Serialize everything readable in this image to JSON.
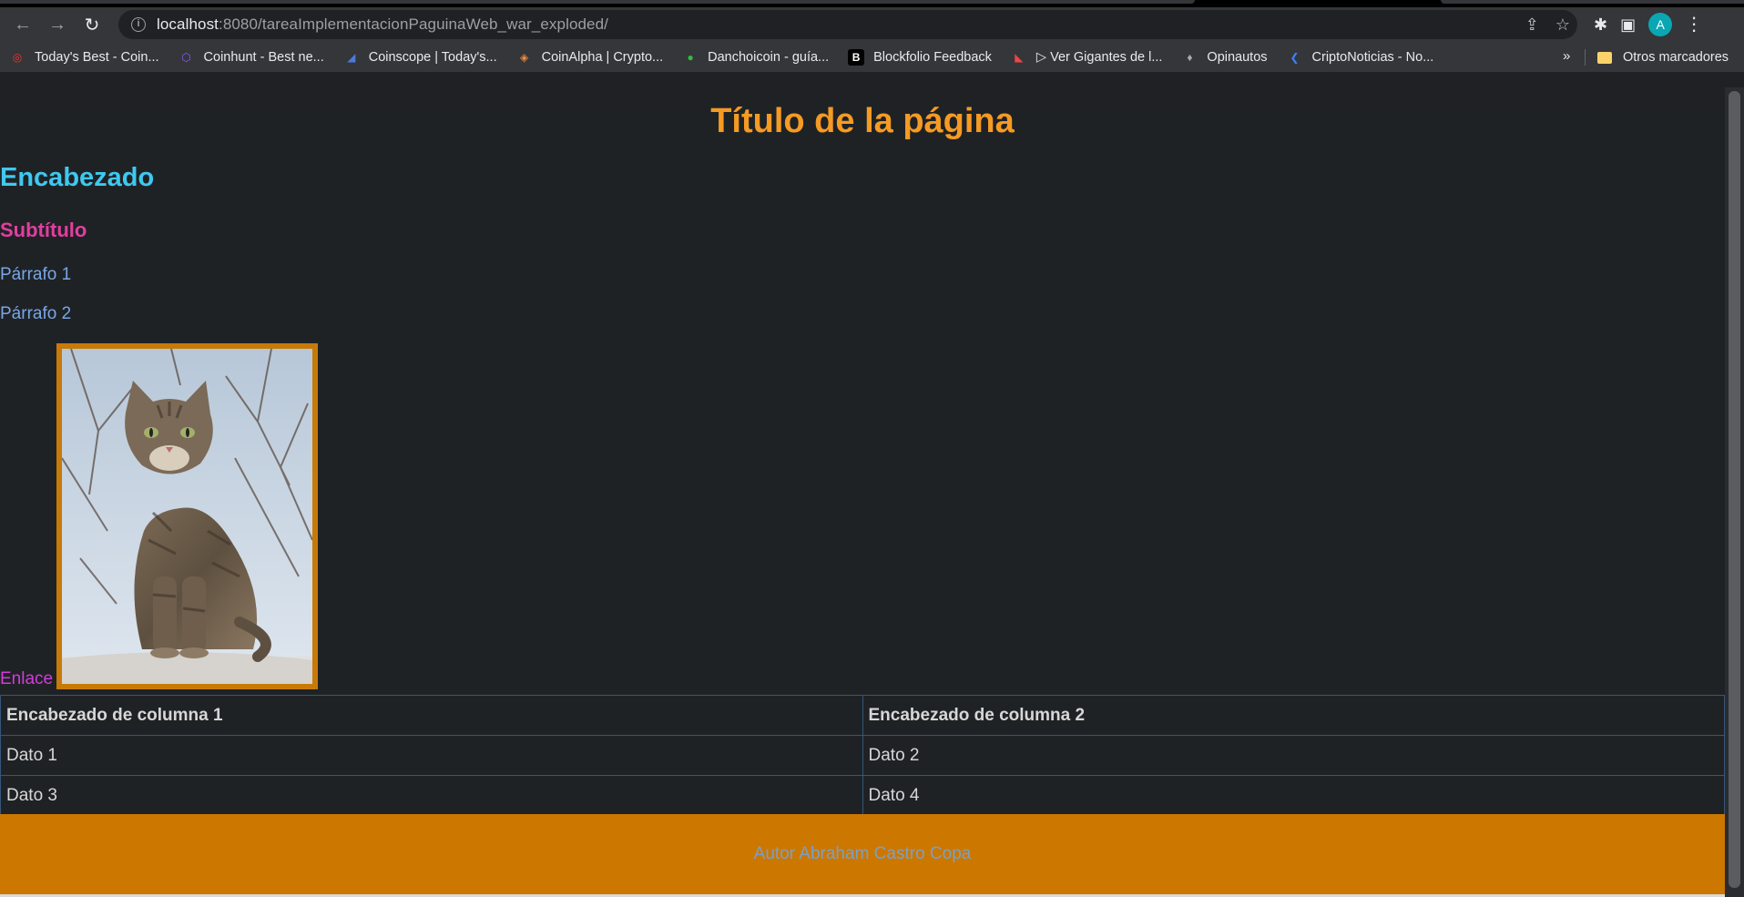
{
  "browser": {
    "url_host": "localhost",
    "url_rest": ":8080/tareaImplementacionPaguinaWeb_war_exploded/",
    "avatar_letter": "A",
    "bookmarks": [
      {
        "label": "Today's Best - Coin...",
        "icon": "coin-target-icon",
        "color": "#e33"
      },
      {
        "label": "Coinhunt - Best ne...",
        "icon": "hexagon-icon",
        "color": "#8a5cf6"
      },
      {
        "label": "Coinscope | Today's...",
        "icon": "coinscope-icon",
        "color": "#4a7be0"
      },
      {
        "label": "CoinAlpha | Crypto...",
        "icon": "diamond-icon",
        "color": "#f08a3c"
      },
      {
        "label": "Danchoicoin - guía...",
        "icon": "green-circle-icon",
        "color": "#2fbf3a"
      },
      {
        "label": "Blockfolio Feedback",
        "icon": "blockfolio-b-icon",
        "color": "#000"
      },
      {
        "label": "▷ Ver Gigantes de l...",
        "icon": "play-logo-icon",
        "color": "#c33"
      },
      {
        "label": "Opinautos",
        "icon": "opinautos-icon",
        "color": "#888"
      },
      {
        "label": "CriptoNoticias - No...",
        "icon": "criptonoticias-icon",
        "color": "#3b82f6"
      }
    ],
    "more_label": "»",
    "other_bookmarks": "Otros marcadores"
  },
  "page": {
    "title": "Título de la página",
    "heading": "Encabezado",
    "subtitle": "Subtítulo",
    "paragraphs": [
      "Párrafo 1",
      "Párrafo 2"
    ],
    "link_text": "Enlace",
    "table": {
      "headers": [
        "Encabezado de columna 1",
        "Encabezado de columna 2"
      ],
      "rows": [
        [
          "Dato 1",
          "Dato 2"
        ],
        [
          "Dato 3",
          "Dato 4"
        ]
      ]
    },
    "footer": "Autor Abraham Castro Copa"
  }
}
